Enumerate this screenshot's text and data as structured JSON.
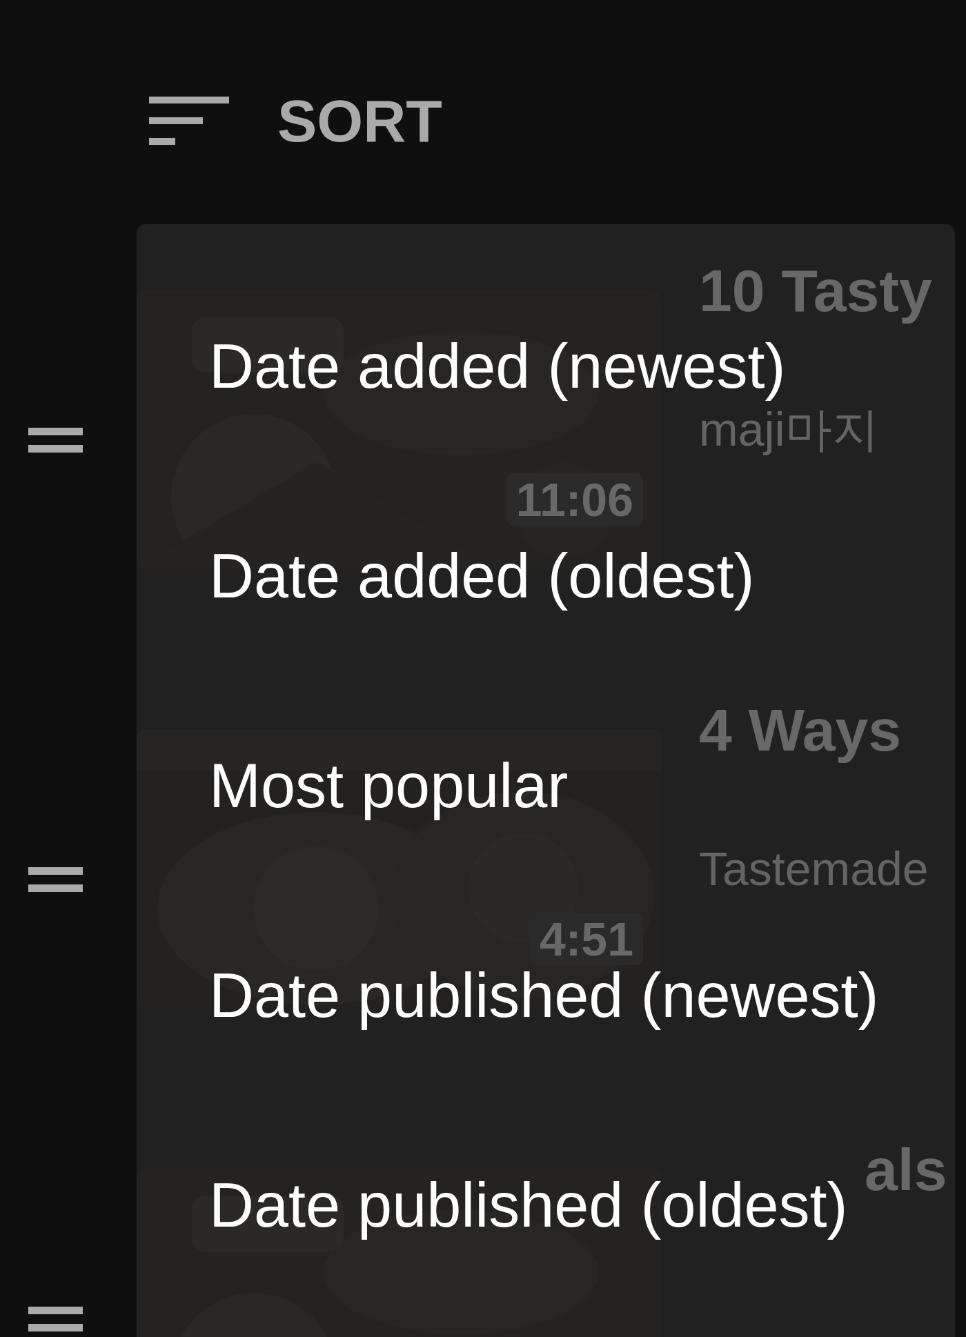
{
  "sort": {
    "label": "SORT"
  },
  "videos": [
    {
      "title": "10 Tasty",
      "channel": "maji마지",
      "duration": "11:06"
    },
    {
      "title": "4 Ways",
      "channel": "Tastemade",
      "duration": "4:51"
    },
    {
      "title": "als"
    }
  ],
  "menu": {
    "items": [
      {
        "label": "Date added (newest)",
        "selected": false
      },
      {
        "label": "Date added (oldest)",
        "selected": false
      },
      {
        "label": "Most popular",
        "selected": false
      },
      {
        "label": "Date published (newest)",
        "selected": false
      },
      {
        "label": "Date published (oldest)",
        "selected": false
      }
    ]
  }
}
